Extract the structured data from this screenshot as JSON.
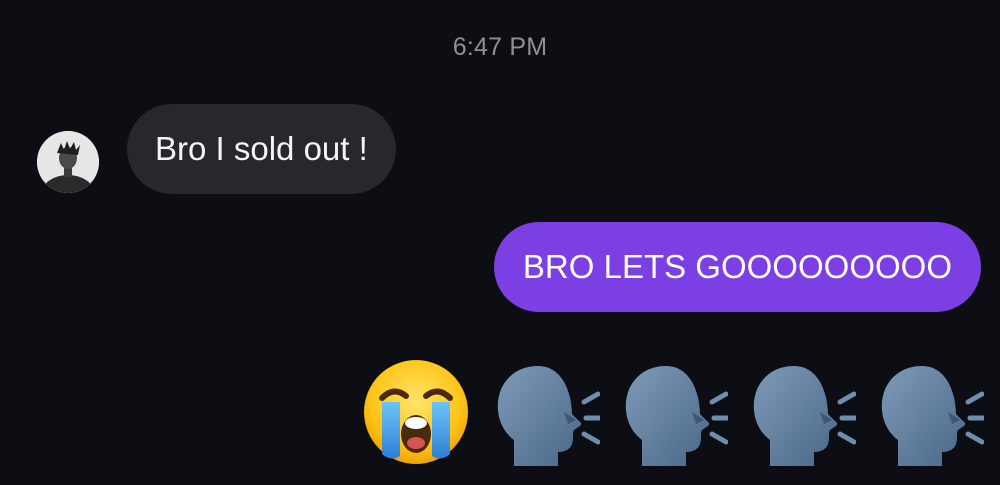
{
  "conversation": {
    "timestamp": "6:47 PM",
    "messages": [
      {
        "direction": "incoming",
        "text": "Bro I sold out !"
      },
      {
        "direction": "outgoing",
        "text": "BRO LETS GOOOOOOOOO"
      }
    ],
    "emoji_message": {
      "direction": "outgoing",
      "emojis": [
        "loudly-crying-face",
        "speaking-head",
        "speaking-head",
        "speaking-head",
        "speaking-head"
      ]
    }
  },
  "colors": {
    "background": "#0c0e13",
    "incoming_bubble": "#26282d",
    "outgoing_bubble": "#7b3fe4",
    "timestamp_text": "#8e9098"
  }
}
